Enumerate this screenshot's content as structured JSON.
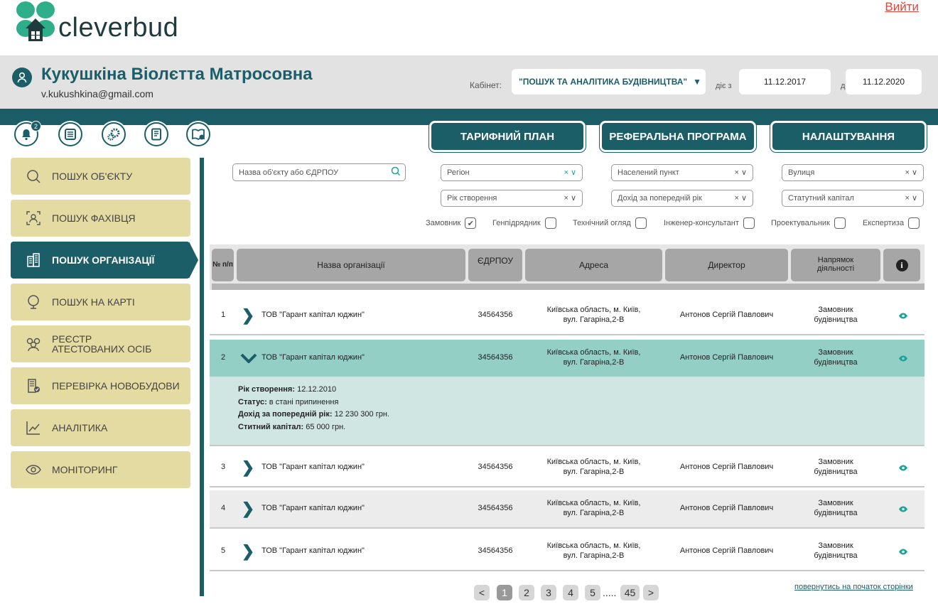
{
  "app": {
    "name": "cleverbud",
    "logout": "Вийти"
  },
  "user": {
    "name": "Кукушкіна Віолєтта Матросовна",
    "email": "v.kukushkina@gmail.com"
  },
  "cabinet": {
    "label": "Кабінет:",
    "value": "\"ПОШУК ТА АНАЛІТИКА БУДІВНИЦТВА\"",
    "from_label": "діє з",
    "from": "11.12.2017",
    "to_label": "до",
    "to": "11.12.2020"
  },
  "toolbar": {
    "notifications_badge": "2",
    "icons": [
      "bell-icon",
      "list-icon",
      "gears-icon",
      "document-icon",
      "book-info-icon"
    ]
  },
  "top_buttons": [
    "ТАРИФНИЙ ПЛАН",
    "РЕФЕРАЛЬНА ПРОГРАМА",
    "НАЛАШТУВАННЯ"
  ],
  "sidebar": {
    "items": [
      {
        "label": "ПОШУК ОБ'ЄКТУ",
        "icon": "search-icon"
      },
      {
        "label": "ПОШУК ФАХІВЦЯ",
        "icon": "person-scan-icon"
      },
      {
        "label": "ПОШУК ОРГАНІЗАЦІЇ",
        "icon": "building-icon",
        "active": true
      },
      {
        "label": "ПОШУК НА КАРТІ",
        "icon": "globe-icon"
      },
      {
        "label": "РЕЄСТР АТЕСТОВАНИХ ОСІБ",
        "icon": "people-icon"
      },
      {
        "label": "ПЕРЕВІРКА НОВОБУДОВИ",
        "icon": "building-check-icon"
      },
      {
        "label": "АНАЛІТИКА",
        "icon": "chart-icon"
      },
      {
        "label": "МОНІТОРИНГ",
        "icon": "eye-icon"
      }
    ]
  },
  "filters": {
    "search_placeholder": "Назва об'єкту або ЄДРПОУ",
    "region": "Регіон",
    "settlement": "Населений пункт",
    "street": "Вулиця",
    "year": "Рік створення",
    "income": "Дохід за попередній рік",
    "capital": "Статутний капітал",
    "clear": "×",
    "chevron": "∨",
    "checkboxes": [
      {
        "label": "Замовник",
        "checked": true
      },
      {
        "label": "Генпідрядник",
        "checked": false
      },
      {
        "label": "Технічний огляд",
        "checked": false
      },
      {
        "label": "Інженер-консультант",
        "checked": false
      },
      {
        "label": "Проектувальник",
        "checked": false
      },
      {
        "label": "Експертиза",
        "checked": false
      }
    ]
  },
  "table": {
    "headers": {
      "num": "№ п/п",
      "name": "Назва організації",
      "edrpou": "ЄДРПОУ",
      "address": "Адреса",
      "director": "Директор",
      "direction": "Напрямок діяльності",
      "info": "i"
    },
    "rows": [
      {
        "n": "1",
        "name": "ТОВ \"Гарант капітал юджин\"",
        "edrpou": "34564356",
        "addr1": "Київська область, м. Київ,",
        "addr2": "вул. Гагаріна,2-В",
        "director": "Антонов Сергій Павлович",
        "dir1": "Замовник",
        "dir2": "будівництва"
      },
      {
        "n": "2",
        "name": "ТОВ \"Гарант капітал юджин\"",
        "edrpou": "34564356",
        "addr1": "Київська область, м. Київ,",
        "addr2": "вул. Гагаріна,2-В",
        "director": "Антонов Сергій Павлович",
        "dir1": "Замовник",
        "dir2": "будівництва"
      },
      {
        "n": "3",
        "name": "ТОВ \"Гарант капітал юджин\"",
        "edrpou": "34564356",
        "addr1": "Київська область, м. Київ,",
        "addr2": "вул. Гагаріна,2-В",
        "director": "Антонов Сергій Павлович",
        "dir1": "Замовник",
        "dir2": "будівництва"
      },
      {
        "n": "4",
        "name": "ТОВ \"Гарант капітал юджин\"",
        "edrpou": "34564356",
        "addr1": "Київська область, м. Київ,",
        "addr2": "вул. Гагаріна,2-В",
        "director": "Антонов Сергій Павлович",
        "dir1": "Замовник",
        "dir2": "будівництва"
      },
      {
        "n": "5",
        "name": "ТОВ \"Гарант капітал юджин\"",
        "edrpou": "34564356",
        "addr1": "Київська область, м. Київ,",
        "addr2": "вул. Гагаріна,2-В",
        "director": "Антонов Сергій Павлович",
        "dir1": "Замовник",
        "dir2": "будівництва"
      }
    ],
    "expanded": {
      "year_label": "Рік створення:",
      "year": "12.12.2010",
      "status_label": "Статус:",
      "status": "в стані припинення",
      "income_label": "Дохід за попередній рік:",
      "income": "12 230 300 грн.",
      "capital_label": "Ститний капітал:",
      "capital": "65 000 грн."
    }
  },
  "pagination": {
    "prev": "<",
    "pages": [
      "1",
      "2",
      "3",
      "4",
      "5"
    ],
    "ellipsis": ".....",
    "last": "45",
    "next": ">",
    "current": "1"
  },
  "back_to_top": "повернутись на початок сторінки",
  "colors": {
    "primary": "#1b5e68",
    "sidebar": "#e4dba3",
    "accent": "#1aa39a",
    "logout": "#e0463b"
  }
}
